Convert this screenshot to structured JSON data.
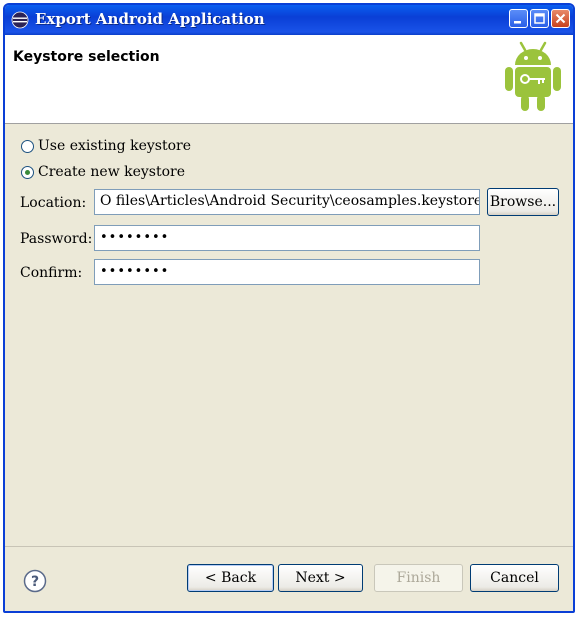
{
  "window": {
    "title": "Export Android Application"
  },
  "header": {
    "title": "Keystore selection"
  },
  "keystore_options": [
    {
      "label": "Use existing keystore",
      "checked": false
    },
    {
      "label": "Create new keystore",
      "checked": true
    }
  ],
  "fields": {
    "location": {
      "label": "Location:",
      "value": "O files\\Articles\\Android Security\\ceosamples.keystore"
    },
    "password": {
      "label": "Password:",
      "value": "••••••••"
    },
    "confirm": {
      "label": "Confirm:",
      "value": "••••••••"
    }
  },
  "buttons": {
    "browse": "Browse...",
    "back": "< Back",
    "next": "Next >",
    "finish": "Finish",
    "cancel": "Cancel"
  },
  "icons": {
    "app": "eclipse-icon",
    "help": "help-icon",
    "logo": "android-logo"
  },
  "colors": {
    "titlebar": "#0a3fd6",
    "dialog_bg": "#ece9d8",
    "android_green": "#9bc33c"
  }
}
